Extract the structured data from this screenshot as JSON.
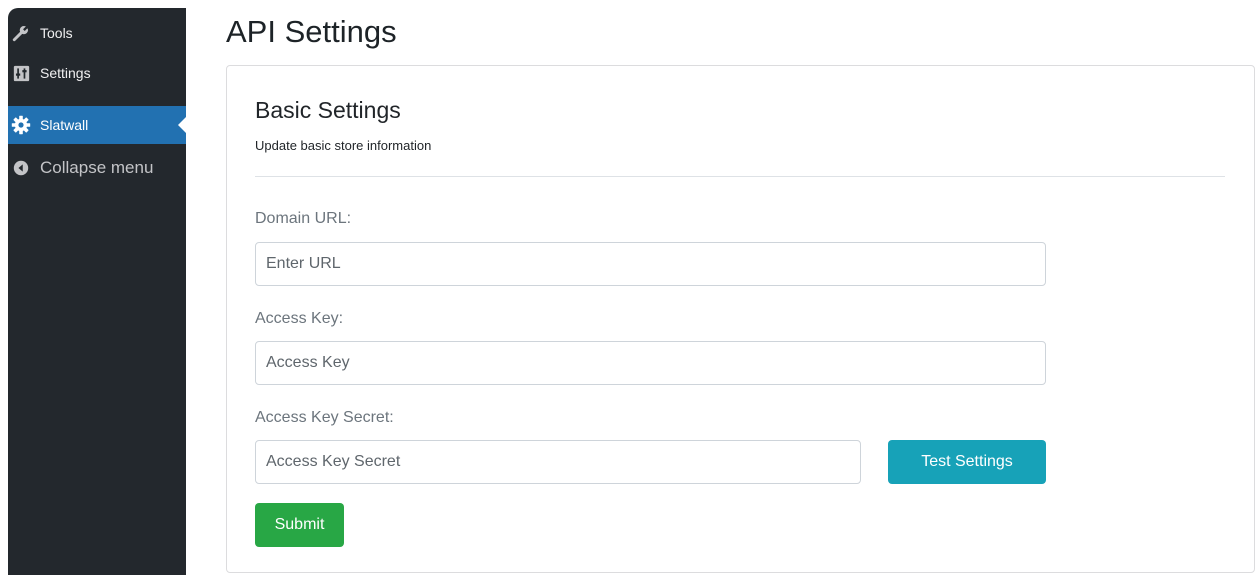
{
  "sidebar": {
    "items": [
      {
        "label": "Tools",
        "icon": "wrench-icon"
      },
      {
        "label": "Settings",
        "icon": "settings-sliders-icon"
      },
      {
        "label": "Slatwall",
        "icon": "gear-icon",
        "active": true
      },
      {
        "label": "Collapse menu",
        "icon": "collapse-arrow-icon"
      }
    ]
  },
  "page": {
    "title": "API Settings"
  },
  "card": {
    "title": "Basic Settings",
    "subtitle": "Update basic store information"
  },
  "form": {
    "domain": {
      "label": "Domain URL:",
      "placeholder": "Enter URL",
      "value": ""
    },
    "access_key": {
      "label": "Access Key:",
      "placeholder": "Access Key",
      "value": ""
    },
    "access_key_secret": {
      "label": "Access Key Secret:",
      "placeholder": "Access Key Secret",
      "value": ""
    },
    "test_button": "Test Settings",
    "submit_button": "Submit"
  },
  "colors": {
    "sidebar_bg": "#23282d",
    "active_menu": "#2271b1",
    "test_button": "#17a2b8",
    "submit_button": "#28a745"
  }
}
